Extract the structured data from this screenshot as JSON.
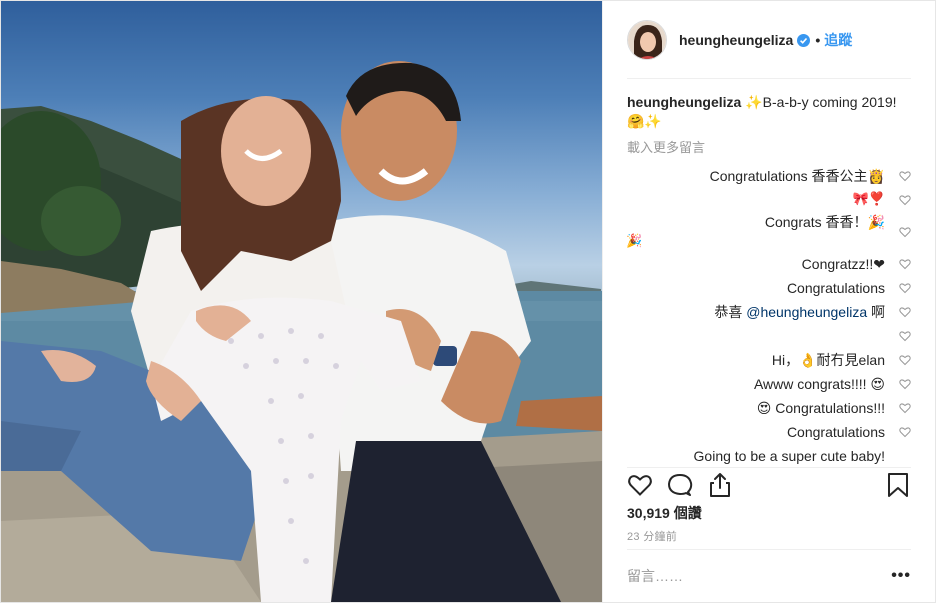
{
  "post": {
    "username": "heungheungeliza",
    "follow_label": "追蹤",
    "dot": "•",
    "caption_user": "heungheungeliza",
    "caption_text": "✨B-a-b-y coming 2019! 🤗✨",
    "load_more": "載入更多留言",
    "comments": [
      {
        "text": "Congratulations 香香公主👸"
      },
      {
        "text": "🎀❣️"
      },
      {
        "text": "Congrats 香香！🎉",
        "cont": "🎉"
      },
      {
        "text": "Congratzz!!❤"
      },
      {
        "text": "Congratulations"
      },
      {
        "pre": "恭喜 ",
        "mention": "@heungheungeliza",
        "post": " 啊"
      },
      {
        "text": ""
      },
      {
        "text": "Hi，👌耐冇見elan"
      },
      {
        "text": "Awww congrats!!!! 😍"
      },
      {
        "text": "😍 Congratulations!!!"
      },
      {
        "text": "Congratulations"
      },
      {
        "text": "Going to be a super cute baby!"
      }
    ],
    "likes": "30,919 個讚",
    "timestamp": "23 分鐘前",
    "comment_placeholder": "留言……",
    "more_label": "•••"
  },
  "icons": {
    "verified": "verified-badge-icon",
    "like": "heart-icon",
    "comment": "comment-bubble-icon",
    "share": "share-icon",
    "save": "bookmark-icon",
    "comment_like": "small-heart-icon"
  },
  "colors": {
    "link": "#3897f0",
    "mention": "#003569",
    "muted": "#999999"
  }
}
